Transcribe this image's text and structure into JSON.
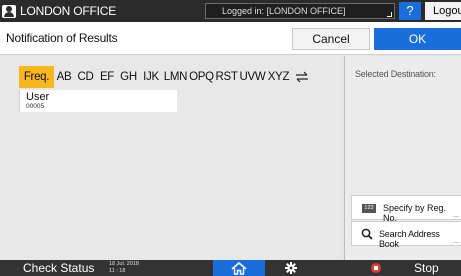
{
  "topbar": {
    "user_name": "LONDON OFFICE",
    "login_status": "Logged in: [LONDON OFFICE]",
    "help_label": "?",
    "logout_label": "Logout"
  },
  "titlebar": {
    "title": "Notification of Results",
    "cancel_label": "Cancel",
    "ok_label": "OK"
  },
  "address_book": {
    "tabs": [
      {
        "label": "Freq.",
        "active": true
      },
      {
        "label": "AB"
      },
      {
        "label": "CD"
      },
      {
        "label": "EF"
      },
      {
        "label": "GH"
      },
      {
        "label": "IJK"
      },
      {
        "label": "LMN"
      },
      {
        "label": "OPQ"
      },
      {
        "label": "RST"
      },
      {
        "label": "UVW"
      },
      {
        "label": "XYZ"
      }
    ],
    "entries": [
      {
        "name": "User",
        "number": "00005"
      }
    ]
  },
  "side": {
    "selected_label": "Selected Destination:",
    "reg_icon_text": "123",
    "reg_label": "Specify by Reg. No.",
    "search_label": "Search Address Book",
    "more": "..."
  },
  "bottombar": {
    "check_status": "Check Status",
    "date": "18 Jul. 2018",
    "time": "11 : 18",
    "stop_label": "Stop"
  },
  "colors": {
    "accent_blue": "#1a6edb",
    "tab_active": "#f6b81c",
    "stop_red": "#e23a3a"
  },
  "icons": [
    "user-icon",
    "moon-icon",
    "swap-icon",
    "search-icon",
    "home-icon",
    "gear-icon",
    "stop-icon"
  ]
}
